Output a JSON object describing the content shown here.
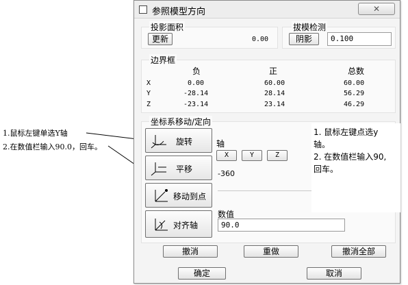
{
  "dialog": {
    "title": "参照模型方向",
    "close_glyph": "✕"
  },
  "proj_area": {
    "legend": "投影面积",
    "update_btn": "更新",
    "value": "0.00"
  },
  "draft_check": {
    "legend": "拔模检测",
    "shade_btn": "阴影",
    "value": "0.100"
  },
  "bbox": {
    "legend": "边界框",
    "headers": [
      "负",
      "正",
      "总数"
    ],
    "rows": [
      {
        "axis": "X",
        "neg": "0.00",
        "pos": "60.00",
        "total": "60.00"
      },
      {
        "axis": "Y",
        "neg": "-28.14",
        "pos": "28.14",
        "total": "56.29"
      },
      {
        "axis": "Z",
        "neg": "-23.14",
        "pos": "23.14",
        "total": "46.29"
      }
    ]
  },
  "coord": {
    "legend": "坐标系移动/定向",
    "buttons": [
      {
        "label": "旋转"
      },
      {
        "label": "平移"
      },
      {
        "label": "移动到点"
      },
      {
        "label": "对齐轴"
      }
    ],
    "axis_label": "轴",
    "axis_buttons": [
      "X",
      "Y",
      "Z"
    ],
    "angle_text": "-360",
    "value_label": "数值",
    "value": "90.0"
  },
  "actions": {
    "undo": "撤消",
    "redo": "重做",
    "undo_all": "撤消全部",
    "ok": "确定",
    "cancel": "取消"
  },
  "annotations": {
    "left_line1": "1.鼠标左键单选Y轴",
    "left_line2": "2.在数值栏输入90.0，回车。",
    "note_lines": [
      "1. 鼠标左键点选y",
      "轴。",
      "2. 在数值栏输入90,",
      "回车。"
    ]
  }
}
